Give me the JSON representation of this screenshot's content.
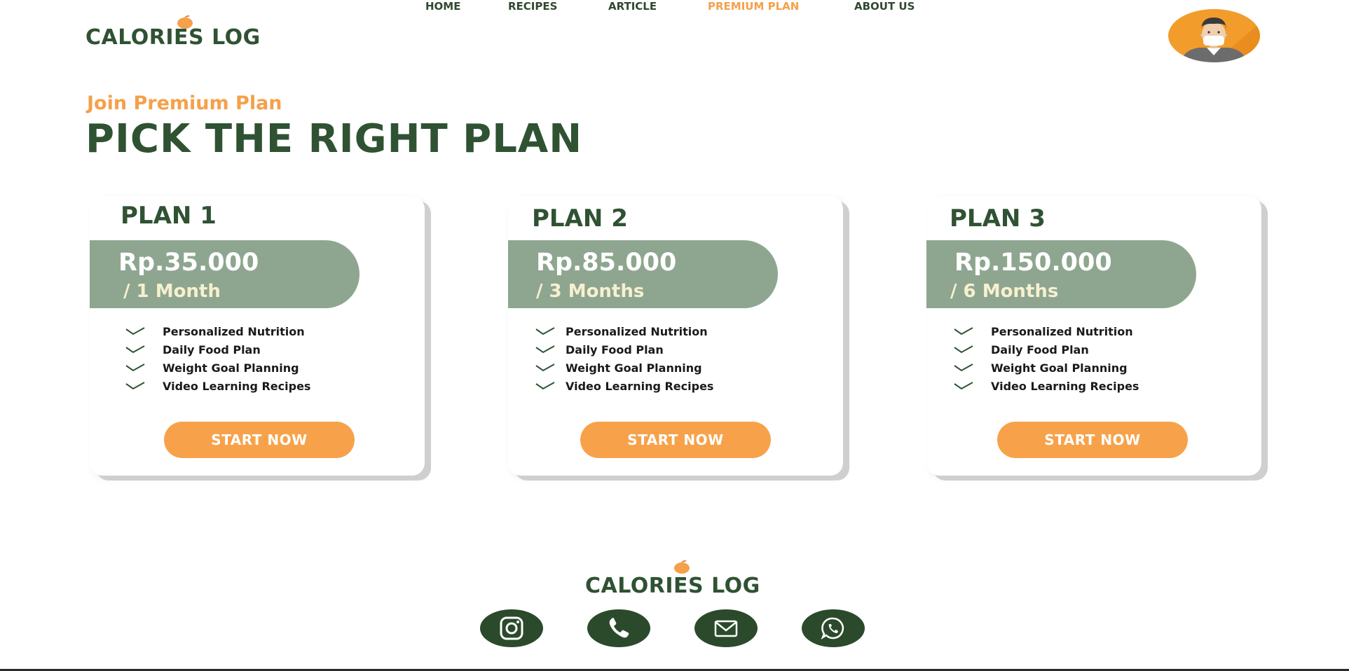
{
  "header": {
    "logo_text": "CALORIES LOG",
    "nav": [
      {
        "label": "HOME",
        "active": false
      },
      {
        "label": "RECIPES",
        "active": false
      },
      {
        "label": "ARTICLE",
        "active": false
      },
      {
        "label": "PREMIUM PLAN",
        "active": true
      },
      {
        "label": "ABOUT US",
        "active": false
      }
    ]
  },
  "hero": {
    "eyebrow": "Join Premium Plan",
    "headline": "PICK THE RIGHT PLAN"
  },
  "plans": [
    {
      "name": "PLAN 1",
      "price": "Rp.35.000",
      "period": "/ 1 Month",
      "features": [
        "Personalized Nutrition",
        "Daily Food Plan",
        "Weight Goal Planning",
        "Video Learning Recipes"
      ],
      "button": "START NOW"
    },
    {
      "name": "PLAN 2",
      "price": "Rp.85.000",
      "period": "/ 3 Months",
      "features": [
        "Personalized Nutrition",
        "Daily Food Plan",
        "Weight Goal Planning",
        "Video Learning Recipes"
      ],
      "button": "START NOW"
    },
    {
      "name": "PLAN 3",
      "price": "Rp.150.000",
      "period": "/ 6 Months",
      "features": [
        "Personalized Nutrition",
        "Daily Food Plan",
        "Weight Goal Planning",
        "Video Learning Recipes"
      ],
      "button": "START NOW"
    }
  ],
  "footer": {
    "logo_text": "CALORIES LOG",
    "social": [
      "instagram-icon",
      "phone-icon",
      "mail-icon",
      "whatsapp-icon"
    ]
  },
  "colors": {
    "brand_green": "#2f5233",
    "accent_orange": "#f5a04a",
    "pill_green": "#8ea690",
    "period_cream": "#f7f0cf"
  }
}
